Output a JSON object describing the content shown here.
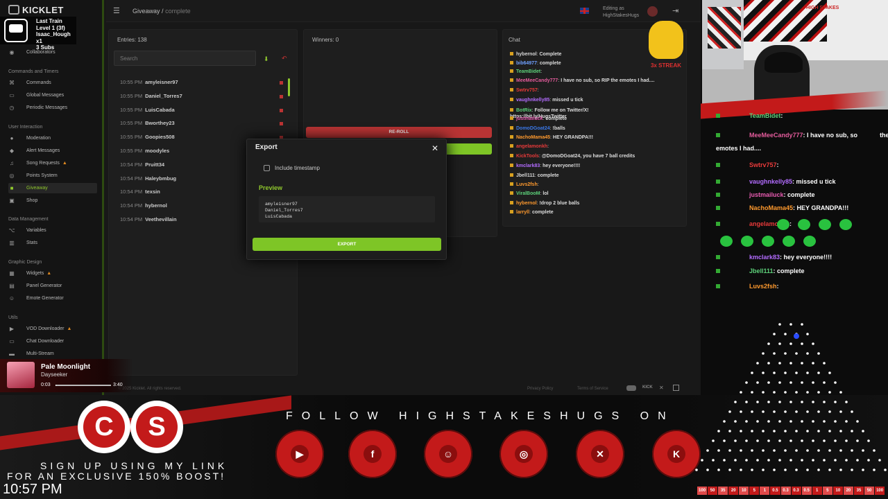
{
  "app": {
    "brand": "KICKLET",
    "breadcrumb": {
      "root": "Giveaway",
      "sep": "/",
      "current": "complete"
    },
    "editing_as": {
      "label": "Editing as",
      "user": "HighStakesHugs"
    },
    "sidebar": {
      "collaborators": "Collaborators",
      "sections": [
        {
          "title": "Commands and Timers",
          "items": [
            "Commands",
            "Global Messages",
            "Periodic Messages"
          ]
        },
        {
          "title": "User Interaction",
          "items": [
            "Moderation",
            "Alert Messages",
            "Song Requests",
            "Points System",
            "Giveaway",
            "Shop"
          ]
        },
        {
          "title": "Data Management",
          "items": [
            "Variables",
            "Stats"
          ]
        },
        {
          "title": "Graphic Design",
          "items": [
            "Widgets",
            "Panel Generator",
            "Emote Generator"
          ]
        },
        {
          "title": "Utils",
          "items": [
            "VOD Downloader",
            "Chat Downloader",
            "Multi-Stream"
          ]
        }
      ]
    },
    "entries": {
      "header": "Entries: 138",
      "search_placeholder": "Search",
      "rows": [
        {
          "time": "10:55 PM",
          "name": "amyleisner97"
        },
        {
          "time": "10:55 PM",
          "name": "Daniel_Torres7"
        },
        {
          "time": "10:55 PM",
          "name": "LuisCabada"
        },
        {
          "time": "10:55 PM",
          "name": "Bworthey23"
        },
        {
          "time": "10:55 PM",
          "name": "Goopies508"
        },
        {
          "time": "10:55 PM",
          "name": "moodyles"
        },
        {
          "time": "10:54 PM",
          "name": "Pruitt34"
        },
        {
          "time": "10:54 PM",
          "name": "Haleybmbug"
        },
        {
          "time": "10:54 PM",
          "name": "texsin"
        },
        {
          "time": "10:54 PM",
          "name": "hybernol"
        },
        {
          "time": "10:54 PM",
          "name": "Veethevillain"
        }
      ]
    },
    "winners": {
      "header": "Winners: 0",
      "reroll": "RE-ROLL"
    },
    "chat": {
      "header": "Chat",
      "lines": [
        {
          "user": "hybernol",
          "text": "Complete",
          "color": "#d8d8d8"
        },
        {
          "user": "bib64977",
          "text": "complete",
          "color": "#6fa0ff"
        },
        {
          "user": "TeamBidet",
          "text": "",
          "color": "#5dd17a"
        },
        {
          "user": "MeeMeeCandy777",
          "text": "I have no sub, so RIP the emotes I had....",
          "color": "#e45c9c"
        },
        {
          "user": "Swtrv757",
          "text": "",
          "color": "#e83a3a"
        },
        {
          "user": "vaughnkelly85",
          "text": "missed u tick",
          "color": "#b36cff"
        },
        {
          "user": "BotRix",
          "text": "Follow me on Twitter/X! https://bit.ly/HugsTwitter",
          "color": "#5dd17a"
        },
        {
          "user": "justmailuck",
          "text": "complete",
          "color": "#e85bb1"
        },
        {
          "user": "DomoDGoat24",
          "text": "!balls",
          "color": "#3a78e8"
        },
        {
          "user": "NachoMama45",
          "text": "HEY GRANDPA!!!",
          "color": "#ff9a2e"
        },
        {
          "user": "angelamonkh",
          "text": "",
          "color": "#e83a3a"
        },
        {
          "user": "KickTools",
          "text": "@DomoDGoat24, you have 7 ball credits",
          "color": "#e83a3a"
        },
        {
          "user": "kmclark83",
          "text": "hey everyone!!!!",
          "color": "#b36cff"
        },
        {
          "user": "Jbell111",
          "text": "complete",
          "color": "#d8d8d8"
        },
        {
          "user": "Luvs2fsh",
          "text": "",
          "color": "#ff9a2e"
        },
        {
          "user": "ViralBooM",
          "text": "lol",
          "color": "#5dd17a"
        },
        {
          "user": "hybernol",
          "text": "!drop 2 blue balls",
          "color": "#ff9a2e"
        },
        {
          "user": "larryll",
          "text": "complete",
          "color": "#ff9a2e"
        }
      ]
    },
    "export_modal": {
      "title": "Export",
      "include_timestamp": "Include timestamp",
      "preview_label": "Preview",
      "preview_lines": [
        "amyleisner97",
        "Daniel_Torres7",
        "LuisCabada"
      ],
      "export_button": "EXPORT"
    },
    "footer": {
      "copyright": "© 2025 Kicklet. All rights reserved.",
      "privacy": "Privacy Policy",
      "terms": "Terms of Service"
    }
  },
  "overlay": {
    "last_train": {
      "title": "Last Train",
      "level": "Level 1 (3f)",
      "user": "Isaac_Hough x1",
      "subs": "3 Subs"
    },
    "streak": "3x STREAK",
    "now_playing": {
      "title": "Pale Moonlight",
      "artist": "Dayseeker",
      "elapsed": "0:03",
      "total": "3:40",
      "progress": 0.014
    },
    "follow_text": "FOLLOW HIGHSTAKESHUGS ON",
    "signup_text_1": "SIGN UP USING MY LINK",
    "signup_text_2": "FOR AN EXCLUSIVE 150% BOOST!",
    "clock": "10:57 PM",
    "cam_badge": "HIGH STAKES",
    "stream_chat": [
      {
        "user": "TeamBidet",
        "text": ":",
        "color": "#5dd17a"
      },
      {
        "user": "MeeMeeCandy777",
        "text": ": I have no sub, so",
        "color": "#e45c9c",
        "tail": "the"
      },
      {
        "user": "",
        "text": "emotes I had....",
        "color": "#fff"
      },
      {
        "user": "Swtrv757",
        "text": ":",
        "color": "#e83a3a"
      },
      {
        "user": "vaughnkelly85",
        "text": ": missed u tick",
        "color": "#b36cff"
      },
      {
        "user": "justmailuck",
        "text": ": complete",
        "color": "#e85bb1"
      },
      {
        "user": "NachoMama45",
        "text": ": HEY GRANDPA!!!",
        "color": "#ff9a2e"
      },
      {
        "user": "angelamonkh",
        "text": ":",
        "color": "#e83a3a"
      },
      {
        "user": "kmclark83",
        "text": ": hey everyone!!!!",
        "color": "#b36cff"
      },
      {
        "user": "Jbell111",
        "text": ": complete",
        "color": "#5dd17a"
      },
      {
        "user": "Luvs2fsh",
        "text": ":",
        "color": "#ff9a2e"
      }
    ],
    "plinko_multipliers": [
      "100",
      "50",
      "35",
      "20",
      "10",
      "5",
      "1",
      "0.5",
      "0.3",
      "0.3",
      "0.5",
      "1",
      "5",
      "10",
      "20",
      "35",
      "50",
      "100"
    ]
  },
  "colors": {
    "accent_green": "#8fc72d",
    "export_green": "#7ec526",
    "reroll_red": "#b83434",
    "brand_red": "#c31a1a"
  }
}
